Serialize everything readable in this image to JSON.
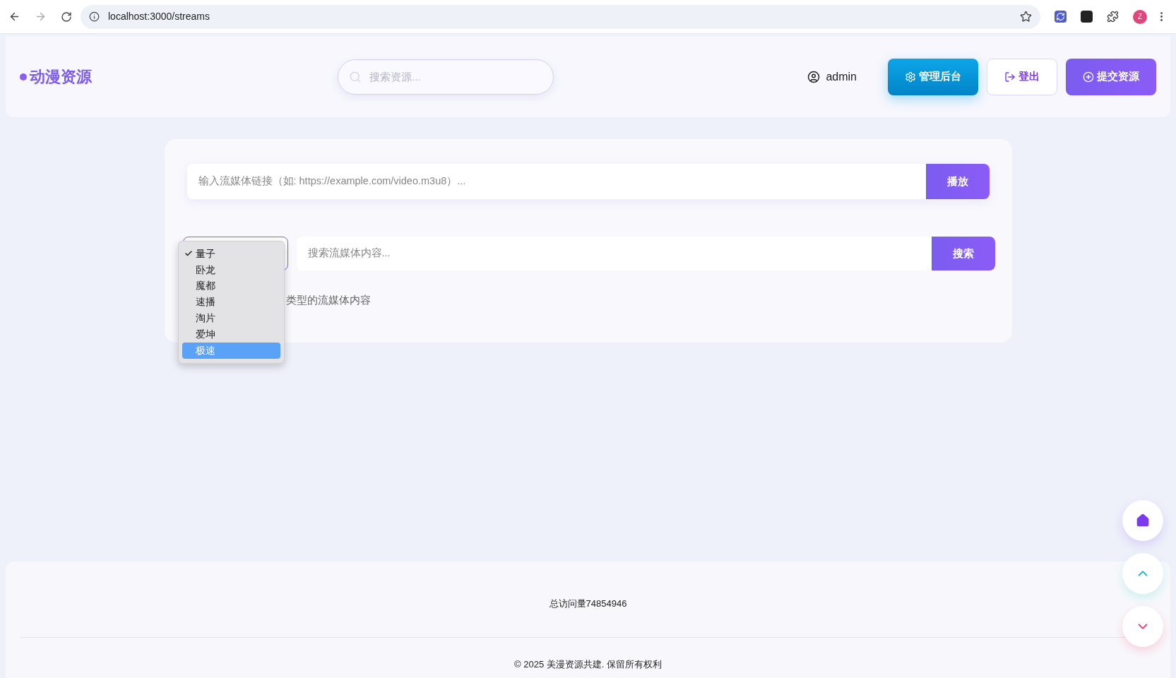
{
  "browser": {
    "url": "localhost:3000/streams",
    "profile_initial": "Z"
  },
  "header": {
    "logo": "动漫资源",
    "search": {
      "placeholder": "搜索资源..."
    },
    "user": "admin",
    "buttons": [
      {
        "kind": "admin",
        "label": "管理后台"
      },
      {
        "kind": "logout",
        "label": "登出"
      },
      {
        "kind": "submit",
        "label": "提交资源"
      }
    ]
  },
  "player": {
    "placeholder": "输入流媒体链接（如: https://example.com/video.m3u8）...",
    "button": "播放"
  },
  "search": {
    "placeholder": "搜索流媒体内容...",
    "button": "搜索",
    "hint": "类型的流媒体内容"
  },
  "dropdown": [
    {
      "label": "量子",
      "checked": true,
      "selected": false
    },
    {
      "label": "卧龙",
      "checked": false,
      "selected": false
    },
    {
      "label": "魔都",
      "checked": false,
      "selected": false
    },
    {
      "label": "速播",
      "checked": false,
      "selected": false
    },
    {
      "label": "淘片",
      "checked": false,
      "selected": false
    },
    {
      "label": "爱坤",
      "checked": false,
      "selected": false
    },
    {
      "label": "极速",
      "checked": false,
      "selected": true
    }
  ],
  "footer": {
    "visits": "总访问量74854946",
    "copyright": "© 2025 美漫资源共建. 保留所有权利"
  }
}
